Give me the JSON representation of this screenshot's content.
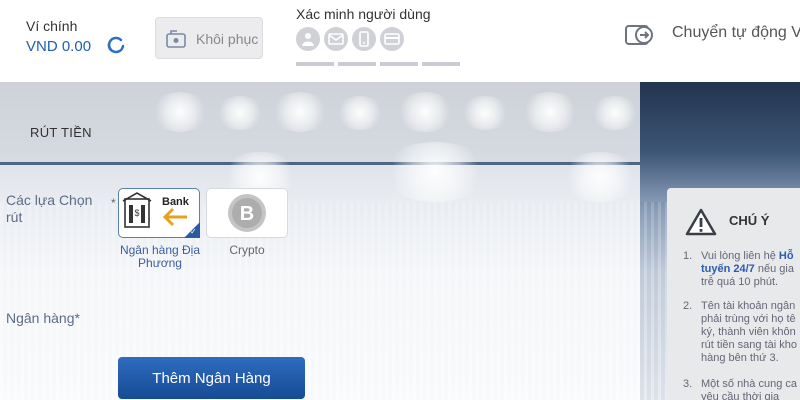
{
  "header": {
    "wallet_label": "Ví chính",
    "wallet_amount": "VND 0.00",
    "restore_label": "Khôi phục",
    "verify_label": "Xác minh người dùng",
    "auto_transfer_label": "Chuyển tự động V"
  },
  "withdraw": {
    "tab_title": "RÚT TIỀN",
    "options_label": "Các lựa Chọn rút",
    "asterisk": "*",
    "options": [
      {
        "caption": "Ngân hàng Địa Phương",
        "icon_text": "Bank",
        "selected": true
      },
      {
        "caption": "Crypto",
        "selected": false
      }
    ],
    "bank_label": "Ngân hàng*",
    "add_bank_button": "Thêm Ngân Hàng"
  },
  "notice": {
    "title": "CHÚ Ý",
    "items": [
      {
        "num": "1.",
        "lines": [
          "Vui lòng liên hệ ",
          "Hỗ",
          "tuyến 24/7",
          " nếu gia",
          "trễ quá 10 phút."
        ]
      },
      {
        "num": "2.",
        "lines": [
          "Tên tài khoản ngân",
          "phải trùng với họ tê",
          "ký, thành viên khôn",
          "rút tiền sang tài kho",
          "hàng bên thứ 3."
        ]
      },
      {
        "num": "3.",
        "lines": [
          "Một số nhà cung ca",
          "yêu cầu thời gia"
        ]
      }
    ]
  },
  "colors": {
    "accent": "#1f5fb0",
    "button": "#174b94",
    "notice_bg": "#e8e9eb"
  }
}
